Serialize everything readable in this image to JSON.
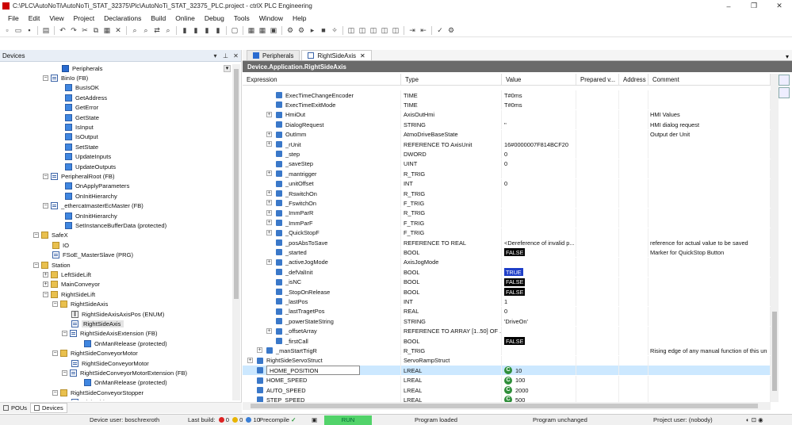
{
  "window": {
    "title": "C:\\PLC\\AutoNoTi\\AutoNoTi_STAT_32375\\Plc\\AutoNoTi_STAT_32375_PLC.project - ctrlX PLC Engineering",
    "minimize": "–",
    "maximize": "❐",
    "close": "✕"
  },
  "menu": [
    "File",
    "Edit",
    "View",
    "Project",
    "Declarations",
    "Build",
    "Online",
    "Debug",
    "Tools",
    "Window",
    "Help"
  ],
  "toolbar": [
    {
      "name": "new-icon",
      "glyph": "▫"
    },
    {
      "name": "open-icon",
      "glyph": "▭"
    },
    {
      "name": "save-icon",
      "glyph": "▪"
    },
    {
      "sep": true
    },
    {
      "name": "print-icon",
      "glyph": "▤"
    },
    {
      "sep": true
    },
    {
      "name": "undo-icon",
      "glyph": "↶"
    },
    {
      "name": "redo-icon",
      "glyph": "↷"
    },
    {
      "name": "cut-icon",
      "glyph": "✂"
    },
    {
      "name": "copy-icon",
      "glyph": "⧉"
    },
    {
      "name": "paste-icon",
      "glyph": "▦"
    },
    {
      "name": "delete-icon",
      "glyph": "✕"
    },
    {
      "sep": true
    },
    {
      "name": "find-icon",
      "glyph": "⌕"
    },
    {
      "name": "find-next-icon",
      "glyph": "⌕"
    },
    {
      "name": "replace-icon",
      "glyph": "⇄"
    },
    {
      "name": "find-all-icon",
      "glyph": "⌕"
    },
    {
      "sep": true
    },
    {
      "name": "bookmark-icon",
      "glyph": "▮"
    },
    {
      "name": "bookmark-next-icon",
      "glyph": "▮"
    },
    {
      "name": "bookmark-prev-icon",
      "glyph": "▮"
    },
    {
      "name": "bookmark-clear-icon",
      "glyph": "▮"
    },
    {
      "sep": true
    },
    {
      "name": "window-icon",
      "glyph": "▢"
    },
    {
      "sep": true
    },
    {
      "name": "build-icon",
      "glyph": "▦"
    },
    {
      "name": "rebuild-icon",
      "glyph": "▦"
    },
    {
      "name": "device-icon",
      "glyph": "▣"
    },
    {
      "sep": true
    },
    {
      "name": "login-icon",
      "glyph": "⚙"
    },
    {
      "name": "logout-icon",
      "glyph": "⚙"
    },
    {
      "name": "start-icon",
      "glyph": "▸"
    },
    {
      "name": "stop-icon",
      "glyph": "■"
    },
    {
      "name": "reset-icon",
      "glyph": "✧"
    },
    {
      "sep": true
    },
    {
      "name": "breakpoint-icon",
      "glyph": "◫"
    },
    {
      "name": "step-over-icon",
      "glyph": "◫"
    },
    {
      "name": "step-into-icon",
      "glyph": "◫"
    },
    {
      "name": "step-out-icon",
      "glyph": "◫"
    },
    {
      "name": "run-to-cursor-icon",
      "glyph": "◫"
    },
    {
      "sep": true
    },
    {
      "name": "write-values-icon",
      "glyph": "⇥"
    },
    {
      "name": "force-values-icon",
      "glyph": "⇤"
    },
    {
      "sep": true
    },
    {
      "name": "check-icon",
      "glyph": "✓"
    },
    {
      "name": "options-icon",
      "glyph": "⚙"
    }
  ],
  "devices": {
    "title": "Devices",
    "pin": "📌",
    "close": "✕",
    "dropdown": "▾",
    "tree": [
      {
        "indent": 78,
        "toggle": "",
        "icon": "dv",
        "label": "Peripherals",
        "dd": true
      },
      {
        "indent": 66,
        "toggle": "−",
        "icon": "pg",
        "label": "BinIo (FB)"
      },
      {
        "indent": 82,
        "toggle": "",
        "icon": "mt",
        "label": "BusIsOK"
      },
      {
        "indent": 82,
        "toggle": "",
        "icon": "mt",
        "label": "GetAddress"
      },
      {
        "indent": 82,
        "toggle": "",
        "icon": "mt",
        "label": "GetError"
      },
      {
        "indent": 82,
        "toggle": "",
        "icon": "mt",
        "label": "GetState"
      },
      {
        "indent": 82,
        "toggle": "",
        "icon": "mt",
        "label": "IsInput"
      },
      {
        "indent": 82,
        "toggle": "",
        "icon": "mt",
        "label": "IsOutput"
      },
      {
        "indent": 82,
        "toggle": "",
        "icon": "mt",
        "label": "SetState"
      },
      {
        "indent": 82,
        "toggle": "",
        "icon": "mt",
        "label": "UpdateInputs"
      },
      {
        "indent": 82,
        "toggle": "",
        "icon": "mt",
        "label": "UpdateOutputs"
      },
      {
        "indent": 66,
        "toggle": "−",
        "icon": "pg",
        "label": "PeripheralRoot (FB)"
      },
      {
        "indent": 82,
        "toggle": "",
        "icon": "mt",
        "label": "OnApplyParameters"
      },
      {
        "indent": 82,
        "toggle": "",
        "icon": "mt",
        "label": "OnInitHierarchy"
      },
      {
        "indent": 66,
        "toggle": "−",
        "icon": "pg",
        "label": "_ethercatmasterEcMaster (FB)"
      },
      {
        "indent": 82,
        "toggle": "",
        "icon": "mt",
        "label": "OnInitHierarchy"
      },
      {
        "indent": 82,
        "toggle": "",
        "icon": "mt",
        "label": "SetInstanceBufferData (protected)"
      },
      {
        "indent": 54,
        "toggle": "−",
        "icon": "fo",
        "label": "SafeX"
      },
      {
        "indent": 66,
        "toggle": "",
        "icon": "fo",
        "label": "IO"
      },
      {
        "indent": 66,
        "toggle": "",
        "icon": "pg",
        "label": "FSoE_MasterSlave (PRG)"
      },
      {
        "indent": 54,
        "toggle": "−",
        "icon": "fo",
        "label": "Station"
      },
      {
        "indent": 66,
        "toggle": "+",
        "icon": "fo",
        "label": "LeftSideLift"
      },
      {
        "indent": 66,
        "toggle": "+",
        "icon": "fo",
        "label": "MainConveyor"
      },
      {
        "indent": 66,
        "toggle": "−",
        "icon": "fo",
        "label": "RightSideLift"
      },
      {
        "indent": 78,
        "toggle": "−",
        "icon": "fo",
        "label": "RightSideAxis"
      },
      {
        "indent": 90,
        "toggle": "",
        "icon": "ev",
        "label": "RightSideAxisAxisPos (ENUM)"
      },
      {
        "indent": 90,
        "toggle": "",
        "icon": "pg",
        "label": "RightSideAxis",
        "selected": true
      },
      {
        "indent": 90,
        "toggle": "−",
        "icon": "pg",
        "label": "RightSideAxisExtension (FB)"
      },
      {
        "indent": 106,
        "toggle": "",
        "icon": "mt",
        "label": "OnManRelease (protected)"
      },
      {
        "indent": 78,
        "toggle": "−",
        "icon": "fo",
        "label": "RightSideConveyorMotor"
      },
      {
        "indent": 90,
        "toggle": "",
        "icon": "pg",
        "label": "RightSideConveyorMotor"
      },
      {
        "indent": 90,
        "toggle": "−",
        "icon": "pg",
        "label": "RightSideConveyorMotorExtension (FB)"
      },
      {
        "indent": 106,
        "toggle": "",
        "icon": "mt",
        "label": "OnManRelease (protected)"
      },
      {
        "indent": 78,
        "toggle": "−",
        "icon": "fo",
        "label": "RightSideConveyorStopper"
      },
      {
        "indent": 90,
        "toggle": "",
        "icon": "pg",
        "label": "RightSideConveyorStopper"
      }
    ],
    "bottom_tabs": [
      "POUs",
      "Devices"
    ]
  },
  "editor": {
    "tabs": [
      {
        "label": "Peripherals",
        "active": false
      },
      {
        "label": "RightSideAxis",
        "active": true
      }
    ],
    "path": "Device.Application.RightSideAxis",
    "columns": [
      "Expression",
      "Type",
      "Value",
      "Prepared v...",
      "Address",
      "Comment"
    ],
    "rows": [
      {
        "lvl": 3,
        "tg": "",
        "nm": "ExecTimeChangeEncoder",
        "type": "TIME",
        "value": "T#0ms",
        "comment": ""
      },
      {
        "lvl": 3,
        "tg": "",
        "nm": "ExecTimeExitMode",
        "type": "TIME",
        "value": "T#0ms",
        "comment": ""
      },
      {
        "lvl": 3,
        "tg": "+",
        "nm": "HmiOut",
        "type": "AxisOutHmi",
        "value": "",
        "comment": "HMI Values"
      },
      {
        "lvl": 3,
        "tg": "",
        "nm": "DialogRequest",
        "type": "STRING",
        "value": "''",
        "comment": "HMI dialog request"
      },
      {
        "lvl": 3,
        "tg": "+",
        "nm": "OutImm",
        "type": "AtmoDriveBaseState",
        "value": "",
        "comment": "Output der Unit"
      },
      {
        "lvl": 3,
        "tg": "+",
        "nm": "_rUnit",
        "type": "REFERENCE TO AxisUnit",
        "value": "16#0000007F814BCF20",
        "comment": ""
      },
      {
        "lvl": 3,
        "tg": "",
        "nm": "_step",
        "type": "DWORD",
        "value": "0",
        "comment": ""
      },
      {
        "lvl": 3,
        "tg": "",
        "nm": "_saveStep",
        "type": "UINT",
        "value": "0",
        "comment": ""
      },
      {
        "lvl": 3,
        "tg": "+",
        "nm": "_mantrigger",
        "type": "R_TRIG",
        "value": "",
        "comment": ""
      },
      {
        "lvl": 3,
        "tg": "",
        "nm": "_unitOffset",
        "type": "INT",
        "value": "0",
        "comment": ""
      },
      {
        "lvl": 3,
        "tg": "+",
        "nm": "_RswitchOn",
        "type": "R_TRIG",
        "value": "",
        "comment": ""
      },
      {
        "lvl": 3,
        "tg": "+",
        "nm": "_FswitchOn",
        "type": "F_TRIG",
        "value": "",
        "comment": ""
      },
      {
        "lvl": 3,
        "tg": "+",
        "nm": "_ImmParR",
        "type": "R_TRIG",
        "value": "",
        "comment": ""
      },
      {
        "lvl": 3,
        "tg": "+",
        "nm": "_ImmParF",
        "type": "F_TRIG",
        "value": "",
        "comment": ""
      },
      {
        "lvl": 3,
        "tg": "+",
        "nm": "_QuickStopF",
        "type": "F_TRIG",
        "value": "",
        "comment": ""
      },
      {
        "lvl": 3,
        "tg": "",
        "nm": "_posAbsToSave",
        "type": "REFERENCE TO REAL",
        "value": "<Dereference of invalid p...",
        "comment": "reference for actual value to be saved"
      },
      {
        "lvl": 3,
        "tg": "",
        "nm": "_started",
        "type": "BOOL",
        "value": "FALSE",
        "badge": "false",
        "comment": "Marker for QuickStop Button"
      },
      {
        "lvl": 3,
        "tg": "+",
        "nm": "_activeJogMode",
        "type": "AxisJogMode",
        "value": "",
        "comment": ""
      },
      {
        "lvl": 3,
        "tg": "",
        "nm": "_defValInit",
        "type": "BOOL",
        "value": "TRUE",
        "badge": "true",
        "comment": ""
      },
      {
        "lvl": 3,
        "tg": "",
        "nm": "_isNC",
        "type": "BOOL",
        "value": "FALSE",
        "badge": "false",
        "comment": ""
      },
      {
        "lvl": 3,
        "tg": "",
        "nm": "_StopOnRelease",
        "type": "BOOL",
        "value": "FALSE",
        "badge": "false",
        "comment": ""
      },
      {
        "lvl": 3,
        "tg": "",
        "nm": "_lastPos",
        "type": "INT",
        "value": "1",
        "comment": ""
      },
      {
        "lvl": 3,
        "tg": "",
        "nm": "_lastTragetPos",
        "type": "REAL",
        "value": "0",
        "comment": ""
      },
      {
        "lvl": 3,
        "tg": "",
        "nm": "_powerStateString",
        "type": "STRING",
        "value": "'DriveOn'",
        "comment": ""
      },
      {
        "lvl": 3,
        "tg": "+",
        "nm": "_offsetArray",
        "type": "REFERENCE TO ARRAY [1..50] OF ...",
        "value": "",
        "comment": ""
      },
      {
        "lvl": 3,
        "tg": "",
        "nm": "_firstCall",
        "type": "BOOL",
        "value": "FALSE",
        "badge": "false",
        "comment": ""
      },
      {
        "lvl": 2,
        "tg": "+",
        "nm": "_manStartTrigR",
        "type": "R_TRIG",
        "value": "",
        "comment": "Rising edge of any manual function of this un"
      },
      {
        "lvl": 1,
        "tg": "+",
        "nm": "RightSideServoStruct",
        "type": "ServoRampStruct",
        "value": "",
        "comment": ""
      },
      {
        "lvl": 1,
        "tg": "",
        "nm": "HOME_POSITION",
        "type": "LREAL",
        "value": "10",
        "const": true,
        "selected": true,
        "box": true,
        "comment": ""
      },
      {
        "lvl": 1,
        "tg": "",
        "nm": "HOME_SPEED",
        "type": "LREAL",
        "value": "100",
        "const": true,
        "comment": ""
      },
      {
        "lvl": 1,
        "tg": "",
        "nm": "AUTO_SPEED",
        "type": "LREAL",
        "value": "2000",
        "const": true,
        "comment": ""
      },
      {
        "lvl": 1,
        "tg": "",
        "nm": "STEP_SPEED",
        "type": "LREAL",
        "value": "500",
        "const": true,
        "comment": ""
      }
    ]
  },
  "status": {
    "device_user": "Device user: boschrexroth",
    "last_build_label": "Last build:",
    "errors": "0",
    "warnings": "0",
    "messages": "10",
    "precompile": "Precompile",
    "run": "RUN",
    "program_loaded": "Program loaded",
    "program_unchanged": "Program unchanged",
    "project_user": "Project user: (nobody)"
  }
}
